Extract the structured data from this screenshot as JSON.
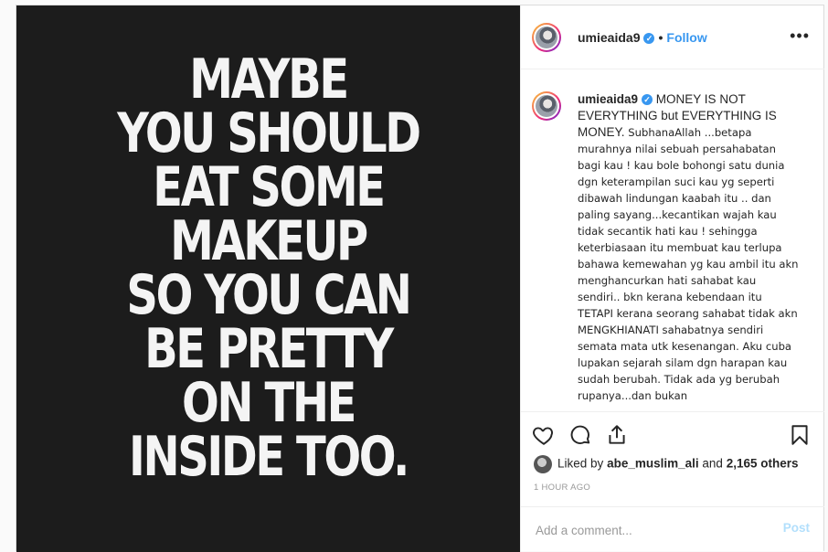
{
  "post": {
    "image_quote_lines": [
      "MAYBE",
      "YOU SHOULD",
      "EAT SOME",
      "MAKEUP",
      "SO YOU CAN",
      "BE PRETTY",
      "ON THE",
      "INSIDE TOO."
    ]
  },
  "header": {
    "username": "umieaida9",
    "separator": "•",
    "follow_label": "Follow",
    "more_label": "•••"
  },
  "caption": {
    "username": "umieaida9",
    "lead_text": "MONEY IS NOT EVERYTHING but EVERYTHING IS MONEY.",
    "body_text": "SubhanaAllah ...betapa murahnya nilai sebuah persahabatan bagi kau ! kau bole bohongi satu dunia dgn keterampilan suci kau yg seperti dibawah lindungan kaabah itu .. dan paling sayang...kecantikan wajah kau tidak secantik hati kau ! sehingga keterbiasaan itu membuat kau terlupa bahawa kemewahan yg kau ambil itu akn menghancurkan hati sahabat kau sendiri.. bkn kerana kebendaan itu TETAPI kerana seorang sahabat tidak akn MENGKHIANATI sahabatnya sendiri semata mata utk kesenangan. Aku cuba lupakan sejarah silam dgn harapan kau sudah berubah. Tidak ada yg berubah rupanya...dan bukan"
  },
  "likes": {
    "prefix": "Liked by",
    "liker": "abe_muslim_ali",
    "and": "and",
    "others": "2,165 others"
  },
  "timestamp": "1 HOUR AGO",
  "comment_box": {
    "placeholder": "Add a comment...",
    "post_label": "Post"
  },
  "colors": {
    "accent": "#3897f0",
    "image_bg": "#1c1c1c",
    "image_text": "#f4f4f4"
  }
}
